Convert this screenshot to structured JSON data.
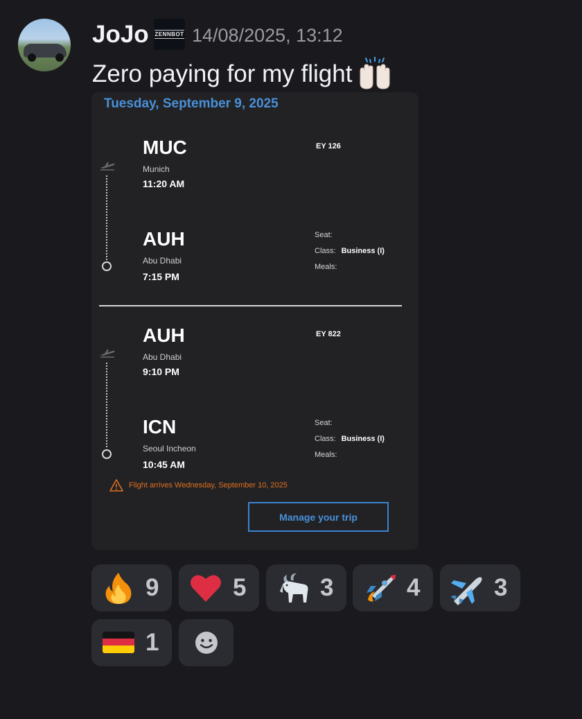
{
  "message": {
    "author": "JoJo",
    "badge_text": "ZENNBOT",
    "timestamp": "14/08/2025, 13:12",
    "text": "Zero paying for my flight",
    "text_emoji": "raising-hands-emoji"
  },
  "card": {
    "date": "Tuesday, September 9, 2025",
    "legs": [
      {
        "flight_no": "EY 126",
        "from": {
          "code": "MUC",
          "city": "Munich",
          "time": "11:20 AM"
        },
        "to": {
          "code": "AUH",
          "city": "Abu Dhabi",
          "time": "7:15 PM"
        },
        "seat_label": "Seat:",
        "class_label": "Class:",
        "class_value": "Business (I)",
        "meals_label": "Meals:"
      },
      {
        "flight_no": "EY 822",
        "from": {
          "code": "AUH",
          "city": "Abu Dhabi",
          "time": "9:10 PM"
        },
        "to": {
          "code": "ICN",
          "city": "Seoul Incheon",
          "time": "10:45 AM"
        },
        "seat_label": "Seat:",
        "class_label": "Class:",
        "class_value": "Business (I)",
        "meals_label": "Meals:"
      }
    ],
    "warning": "Flight arrives Wednesday, September 10, 2025",
    "manage_label": "Manage your trip"
  },
  "reactions": [
    {
      "icon": "fire-emoji",
      "count": "9"
    },
    {
      "icon": "heart-emoji",
      "count": "5"
    },
    {
      "icon": "goat-emoji",
      "count": "3"
    },
    {
      "icon": "rocket-emoji",
      "count": "4"
    },
    {
      "icon": "airplane-emoji",
      "count": "3"
    },
    {
      "icon": "germany-flag-emoji",
      "count": "1"
    },
    {
      "icon": "add-reaction-icon",
      "count": ""
    }
  ],
  "colors": {
    "background": "#1a1a1e",
    "card": "#222225",
    "accent_blue": "#4a90d9",
    "warning_orange": "#e26f1d",
    "reaction_bg": "#2b2c31"
  }
}
